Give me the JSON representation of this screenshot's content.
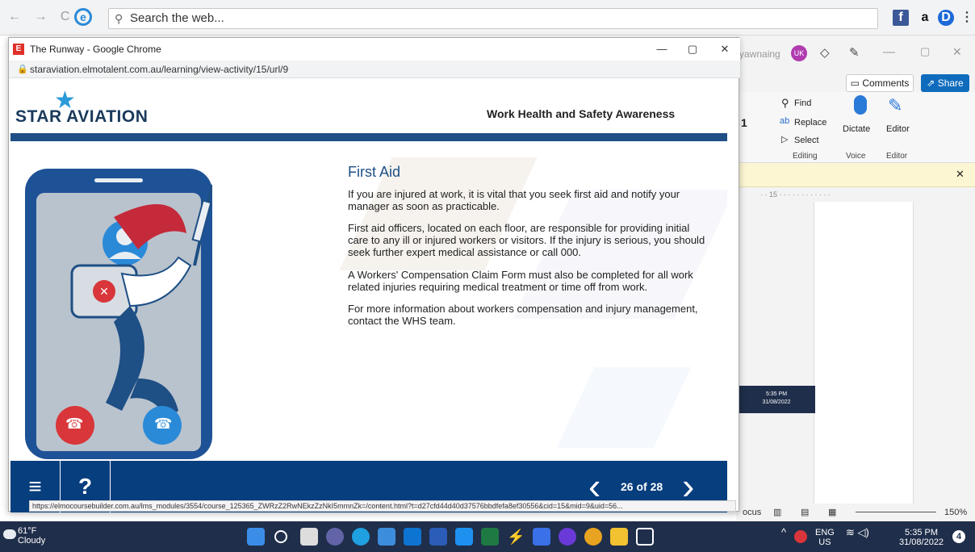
{
  "topbar": {
    "search_placeholder": "Search the web...",
    "icon_a": "a"
  },
  "word": {
    "user": "yawnaing",
    "user_initials": "UK",
    "comments_label": "Comments",
    "share_label": "Share",
    "font_size": "1",
    "find_label": "Find",
    "replace_label": "Replace",
    "select_label": "Select",
    "dictate_label": "Dictate",
    "editor_label": "Editor",
    "group_editing": "Editing",
    "group_voice": "Voice",
    "group_editor": "Editor",
    "ruler_text": "· · 15 · · · · · · · · · · · ·",
    "focus_label": "ocus",
    "zoom": "150%",
    "mini_time": "5:35 PM",
    "mini_date": "31/08/2022"
  },
  "chrome": {
    "title": "The Runway - Google Chrome",
    "url": "staraviation.elmotalent.com.au/learning/view-activity/15/url/9",
    "status_url": "https://elmocoursebuilder.com.au/lms_modules/3554/course_125365_ZWRzZ2RwNEkzZzNkI5mmnZk=/content.html?t=d27cfd44d40d37576bbdfefa8ef30556&cid=15&mid=9&uid=56..."
  },
  "course": {
    "brand": "STAR AVIATION",
    "module_title": "Work Health and Safety Awareness",
    "heading": "First Aid",
    "paragraphs": [
      "If you are injured at work, it is vital that you seek first aid and notify your manager as soon as practicable.",
      "First aid officers, located on each floor, are responsible for providing initial care to any ill or injured workers or visitors. If the injury is serious, you should seek further expert medical assistance or call 000.",
      "A Workers' Compensation Claim Form must also be completed for all work related injuries requiring medical treatment or time off from work.",
      "For more information about workers compensation and injury management, contact the WHS team."
    ],
    "pager": "26 of 28",
    "help_label": "?"
  },
  "taskbar": {
    "temp": "61°F",
    "condition": "Cloudy",
    "lang1": "ENG",
    "lang2": "US",
    "time": "5:35 PM",
    "date": "31/08/2022",
    "notif_count": "4"
  },
  "colors": {
    "brand_blue": "#1e4f85",
    "footer_blue": "#063e7e",
    "accent": "#2a9ad8"
  }
}
